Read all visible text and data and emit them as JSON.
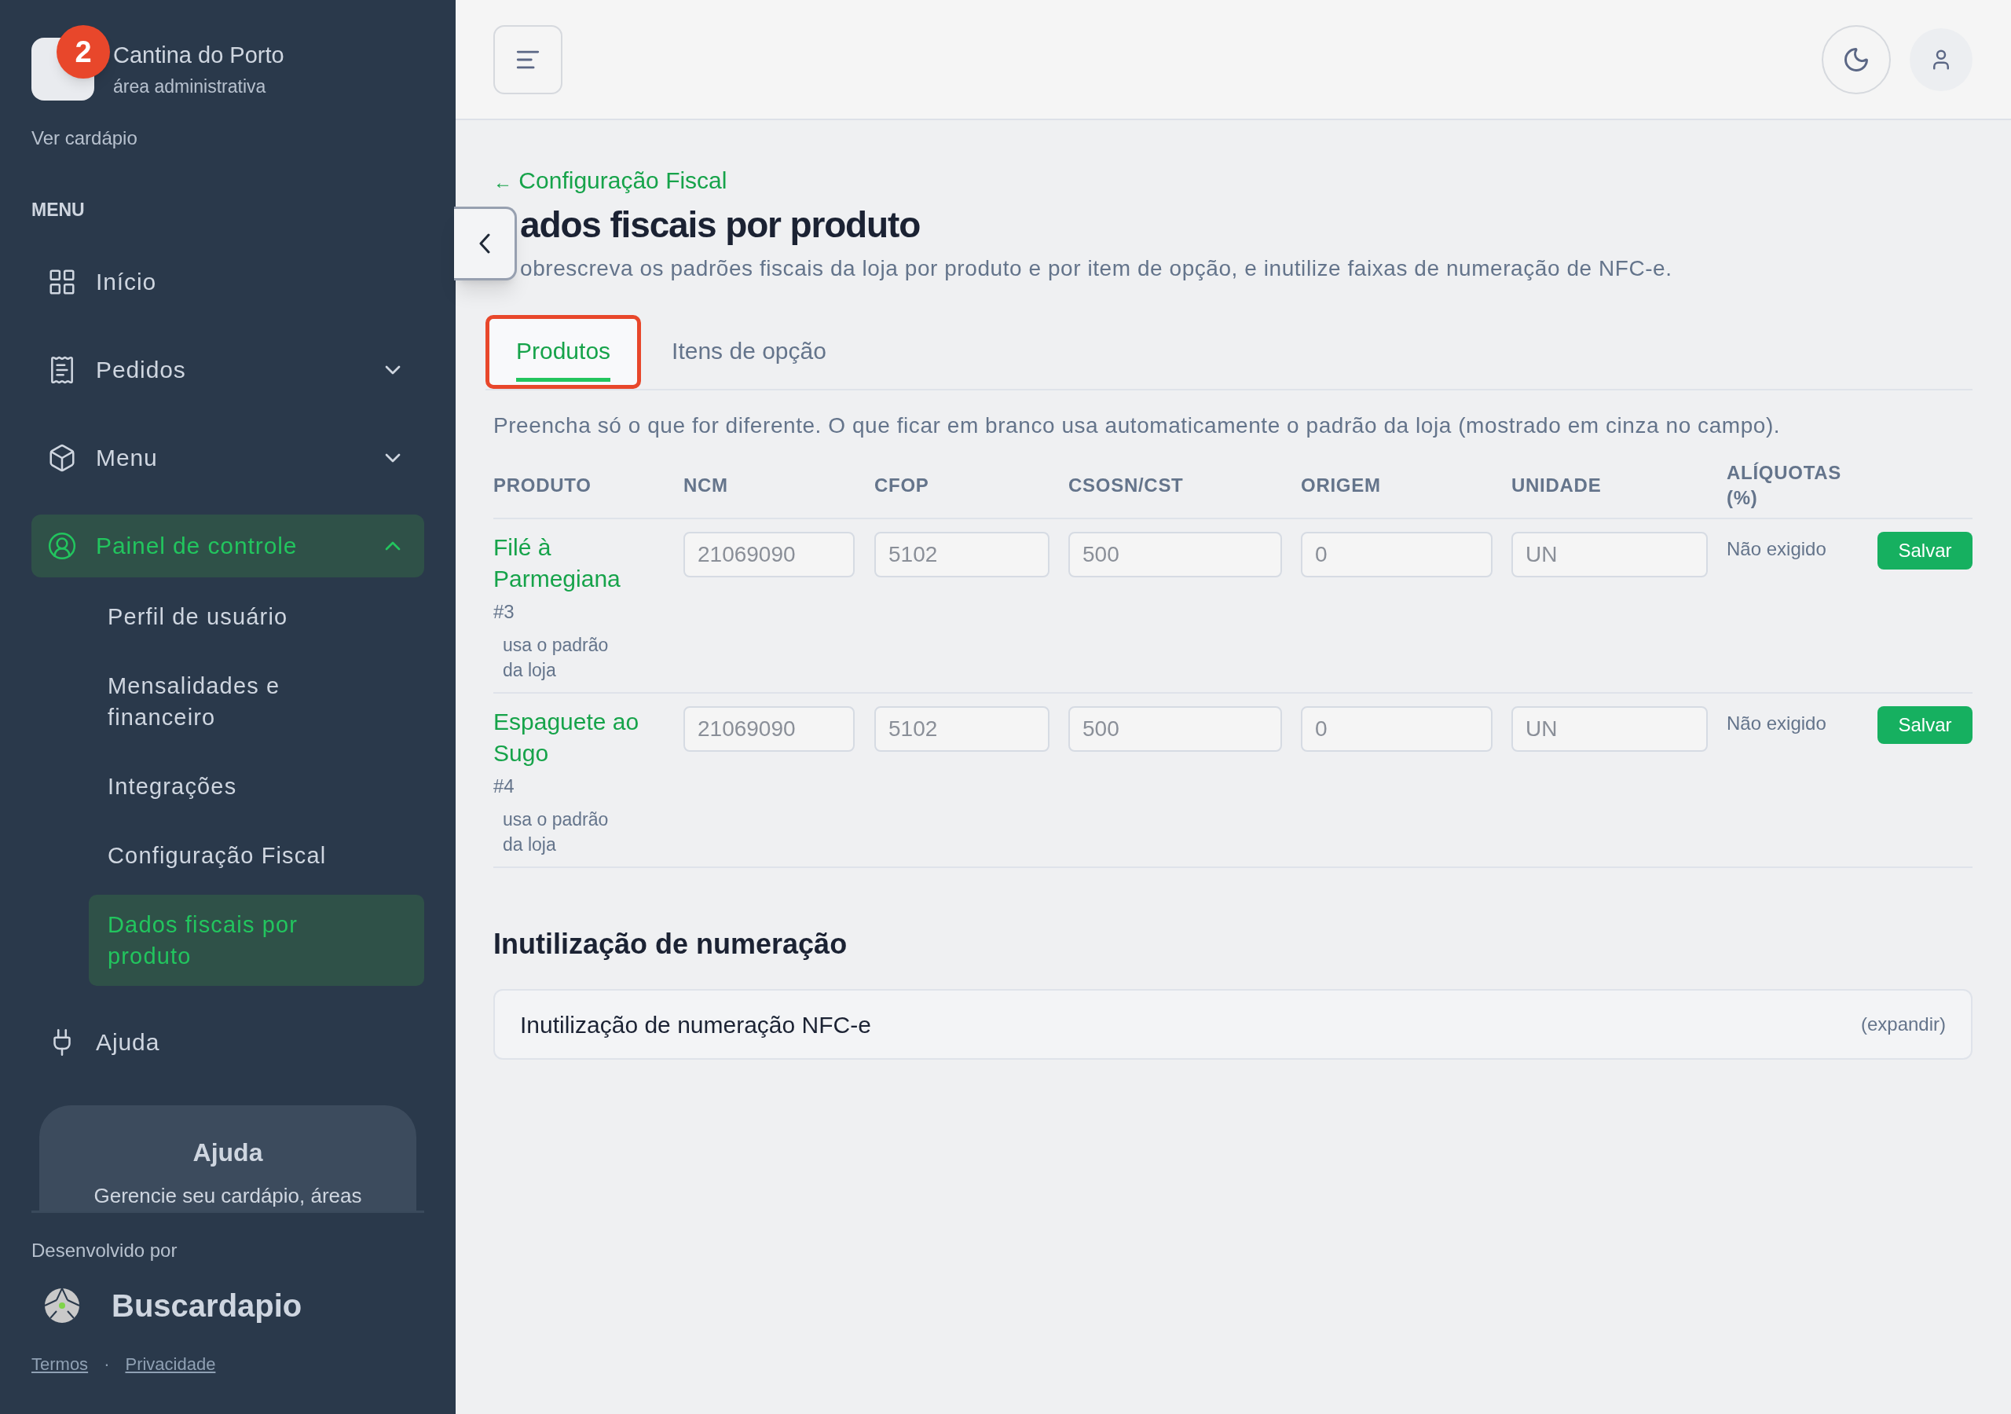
{
  "sidebar": {
    "step_badge": "2",
    "store_name": "Cantina do Porto",
    "store_subtitle": "área administrativa",
    "view_menu_link": "Ver cardápio",
    "section_label": "MENU",
    "items": [
      {
        "label": "Início",
        "selected": false
      },
      {
        "label": "Pedidos",
        "selected": false,
        "expanded": false
      },
      {
        "label": "Menu",
        "selected": false,
        "expanded": false
      },
      {
        "label": "Painel de controle",
        "selected": true,
        "expanded": true,
        "children": [
          {
            "label": "Perfil de usuário",
            "selected": false
          },
          {
            "label": "Mensalidades e financeiro",
            "selected": false
          },
          {
            "label": "Integrações",
            "selected": false
          },
          {
            "label": "Configuração Fiscal",
            "selected": false
          },
          {
            "label": "Dados fiscais por produto",
            "selected": true
          }
        ]
      },
      {
        "label": "Ajuda",
        "selected": false
      }
    ],
    "help_card": {
      "title": "Ajuda",
      "text": "Gerencie seu cardápio, áreas"
    },
    "developed_by": "Desenvolvido por",
    "brand": "Buscardapio",
    "footer_links": [
      "Termos",
      "Privacidade"
    ],
    "footer_separator": "·"
  },
  "breadcrumb": {
    "arrow": "←",
    "label": "Configuração Fiscal"
  },
  "title": "ados fiscais por produto",
  "subtitle": "obrescreva os padrões fiscais da loja por produto e por item de opção, e inutilize faixas de numeração de NFC-e.",
  "tabs": [
    {
      "label": "Produtos",
      "selected": true,
      "highlighted": true
    },
    {
      "label": "Itens de opção",
      "selected": false,
      "highlighted": false
    }
  ],
  "hint": "Preencha só o que for diferente. O que ficar em branco usa automaticamente o padrão da loja (mostrado em cinza no campo).",
  "table": {
    "columns": [
      "PRODUTO",
      "NCM",
      "CFOP",
      "CSOSN/CST",
      "ORIGEM",
      "UNIDADE",
      "ALÍQUOTAS (%)"
    ],
    "rows": [
      {
        "name": "Filé à Parmegiana",
        "id": "#3",
        "note": "usa o padrão da loja",
        "placeholders": [
          "21069090",
          "5102",
          "500",
          "0",
          "UN"
        ],
        "rates": "Não exigido",
        "action": "Salvar"
      },
      {
        "name": "Espaguete ao Sugo",
        "id": "#4",
        "note": "usa o padrão da loja",
        "placeholders": [
          "21069090",
          "5102",
          "500",
          "0",
          "UN"
        ],
        "rates": "Não exigido",
        "action": "Salvar"
      }
    ]
  },
  "section_title": "Inutilização de numeração",
  "accordion": {
    "label": "Inutilização de numeração NFC-e",
    "toggle": "(expandir)",
    "expanded": false
  }
}
